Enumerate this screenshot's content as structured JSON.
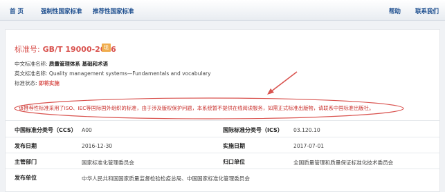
{
  "nav": {
    "home": "首 页",
    "mandatory": "强制性国家标准",
    "recommended": "推荐性国家标准",
    "help": "帮助",
    "contact": "联系我们"
  },
  "standard": {
    "number_label": "标准号:",
    "number": "GB/T 19000-2016",
    "badge": "现",
    "cn_name_label": "中文标准名称:",
    "cn_name": "质量管理体系 基础和术语",
    "en_name_label": "英文标准名称:",
    "en_name": "Quality management systems—Fundamentals and vocabulary",
    "status_label": "标准状态:",
    "status": "即将实施"
  },
  "notice": "该推荐性标准采用了ISO、IEC等国际国外组织的标准，由于涉及版权保护问题，本系统暂不提供在线阅读服务，如需正式标准出版物，请联系中国标准出版社。",
  "details": [
    {
      "label": "中国标准分类号（CCS）",
      "value": "A00",
      "label2": "国际标准分类号（ICS）",
      "value2": "03.120.10"
    },
    {
      "label": "发布日期",
      "value": "2016-12-30",
      "label2": "实施日期",
      "value2": "2017-07-01"
    },
    {
      "label": "主管部门",
      "value": "国家标准化管理委员会",
      "label2": "归口单位",
      "value2": "全国质量管理和质量保证标准化技术委员会"
    },
    {
      "label": "发布单位",
      "value": "中华人民共和国国家质量监督检验检疫总局、中国国家标准化管理委员会",
      "label2": "",
      "value2": ""
    }
  ],
  "colors": {
    "accent_red": "#d9534f",
    "nav_blue": "#1e4f8f",
    "badge_orange": "#f0ad4e"
  }
}
